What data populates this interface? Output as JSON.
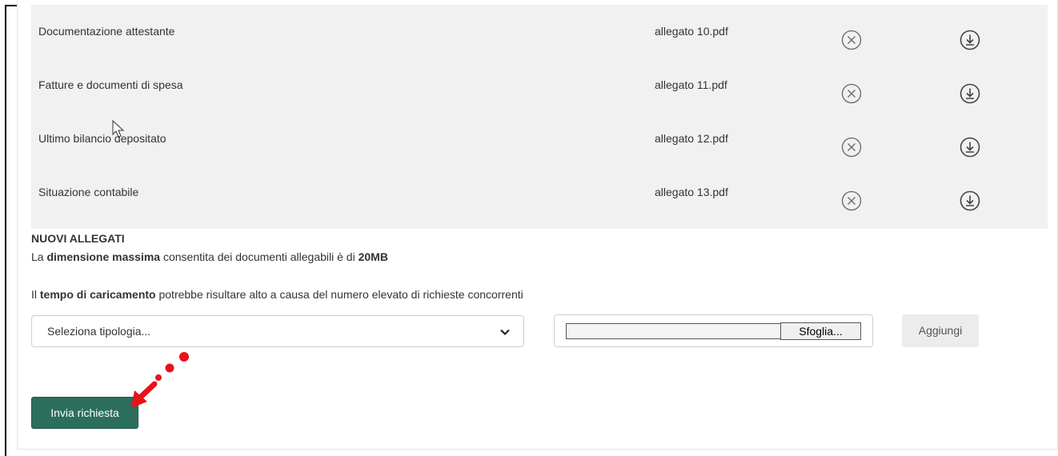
{
  "attachments": [
    {
      "description": "Documentazione attestante",
      "file": "allegato 10.pdf"
    },
    {
      "description": "Fatture e documenti di spesa",
      "file": "allegato 11.pdf"
    },
    {
      "description": "Ultimo bilancio depositato",
      "file": "allegato 12.pdf"
    },
    {
      "description": "Situazione contabile",
      "file": "allegato 13.pdf"
    }
  ],
  "icons": {
    "delete": "circle-x-icon",
    "download": "download-circle-icon"
  },
  "new_attachments": {
    "title": "NUOVI ALLEGATI",
    "max_size_prefix": "La ",
    "max_size_bold": "dimensione massima",
    "max_size_mid": " consentita dei documenti allegabili è di ",
    "max_size_value": "20MB",
    "upload_prefix": "Il ",
    "upload_bold": "tempo di caricamento",
    "upload_suffix": " potrebbe risultare alto a causa del numero elevato di richieste concorrenti",
    "select_placeholder": "Seleziona tipologia...",
    "browse_label": "Sfoglia...",
    "file_value": "",
    "add_label": "Aggiungi"
  },
  "submit_label": "Invia richiesta",
  "colors": {
    "primary": "#2c6e5c",
    "annotation": "#e8121b",
    "table_bg": "#f1f1f1"
  }
}
